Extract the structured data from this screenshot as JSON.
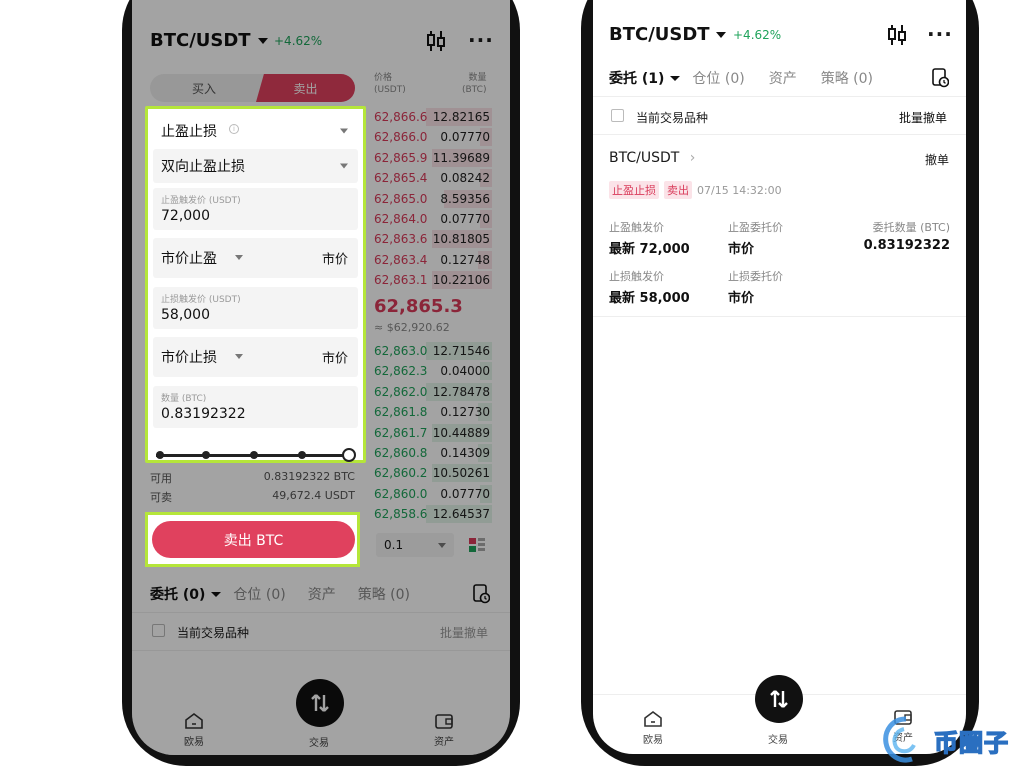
{
  "left": {
    "header": {
      "pair": "BTC/USDT",
      "change": "+4.62%"
    },
    "side_tabs": {
      "buy": "买入",
      "sell": "卖出"
    },
    "order_type": "止盈止损",
    "mode": "双向止盈止损",
    "tp_trigger": {
      "label": "止盈触发价 (USDT)",
      "value": "72,000"
    },
    "tp_order": {
      "type": "市价止盈",
      "price": "市价"
    },
    "sl_trigger": {
      "label": "止损触发价 (USDT)",
      "value": "58,000"
    },
    "sl_order": {
      "type": "市价止损",
      "price": "市价"
    },
    "amount": {
      "label": "数量 (BTC)",
      "value": "0.83192322"
    },
    "available": {
      "label": "可用",
      "value": "0.83192322 BTC"
    },
    "sellable": {
      "label": "可卖",
      "value": "49,672.4 USDT"
    },
    "submit": "卖出 BTC",
    "orderbook": {
      "price_header": "价格",
      "price_unit": "(USDT)",
      "qty_header": "数量",
      "qty_unit": "(BTC)",
      "asks": [
        {
          "price": "62,866.6",
          "qty": "12.82165",
          "depth": 0.55
        },
        {
          "price": "62,866.0",
          "qty": "0.07770",
          "depth": 0.1
        },
        {
          "price": "62,865.9",
          "qty": "11.39689",
          "depth": 0.5
        },
        {
          "price": "62,865.4",
          "qty": "0.08242",
          "depth": 0.1
        },
        {
          "price": "62,865.0",
          "qty": "8.59356",
          "depth": 0.4
        },
        {
          "price": "62,864.0",
          "qty": "0.07770",
          "depth": 0.1
        },
        {
          "price": "62,863.6",
          "qty": "10.81805",
          "depth": 0.5
        },
        {
          "price": "62,863.4",
          "qty": "0.12748",
          "depth": 0.12
        },
        {
          "price": "62,863.1",
          "qty": "10.22106",
          "depth": 0.5
        }
      ],
      "last_price": "62,865.3",
      "last_price_usd": "≈ $62,920.62",
      "bids": [
        {
          "price": "62,863.0",
          "qty": "12.71546",
          "depth": 0.55
        },
        {
          "price": "62,862.3",
          "qty": "0.04000",
          "depth": 0.1
        },
        {
          "price": "62,862.0",
          "qty": "12.78478",
          "depth": 0.55
        },
        {
          "price": "62,861.8",
          "qty": "0.12730",
          "depth": 0.12
        },
        {
          "price": "62,861.7",
          "qty": "10.44889",
          "depth": 0.5
        },
        {
          "price": "62,860.8",
          "qty": "0.14309",
          "depth": 0.12
        },
        {
          "price": "62,860.2",
          "qty": "10.50261",
          "depth": 0.5
        },
        {
          "price": "62,860.0",
          "qty": "0.07770",
          "depth": 0.1
        },
        {
          "price": "62,858.6",
          "qty": "12.64537",
          "depth": 0.55
        }
      ],
      "precision": "0.1"
    },
    "bottom_tabs": [
      "委托 (0)",
      "仓位 (0)",
      "资产",
      "策略 (0)"
    ],
    "current_pair_filter": "当前交易品种",
    "batch_cancel": "批量撤单",
    "nav": {
      "home": "欧易",
      "trade": "交易",
      "assets": "资产"
    }
  },
  "right": {
    "header": {
      "pair": "BTC/USDT",
      "change": "+4.62%"
    },
    "tabs": [
      "委托 (1)",
      "仓位 (0)",
      "资产",
      "策略 (0)"
    ],
    "current_pair_filter": "当前交易品种",
    "batch_cancel": "批量撤单",
    "order": {
      "pair": "BTC/USDT",
      "cancel": "撤单",
      "tag_type": "止盈止损",
      "tag_side": "卖出",
      "time": "07/15 14:32:00",
      "tp_trigger_label": "止盈触发价",
      "tp_trigger_value": "最新 72,000",
      "tp_order_label": "止盈委托价",
      "tp_order_value": "市价",
      "qty_label": "委托数量 (BTC)",
      "qty_value": "0.83192322",
      "sl_trigger_label": "止损触发价",
      "sl_trigger_value": "最新 58,000",
      "sl_order_label": "止损委托价",
      "sl_order_value": "市价"
    },
    "nav": {
      "home": "欧易",
      "trade": "交易",
      "assets": "资产"
    }
  },
  "watermark": "币圈子",
  "colors": {
    "sell": "#e0415e",
    "buy": "#1fa35b",
    "highlight": "#b5e63a"
  }
}
